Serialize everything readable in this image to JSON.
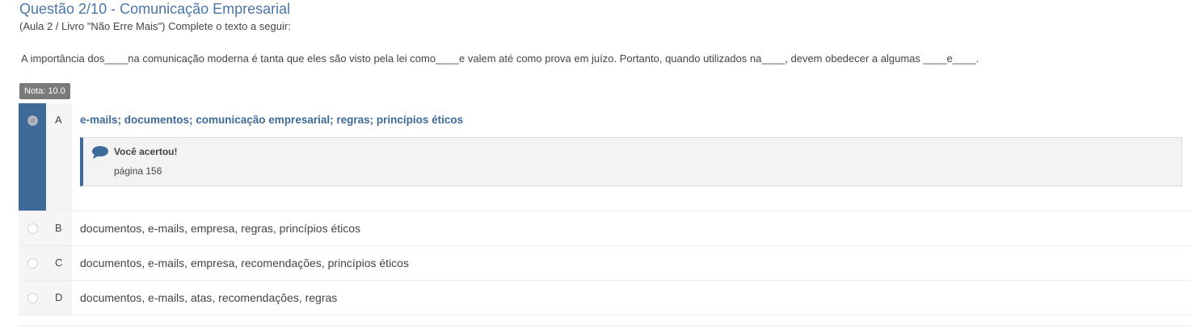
{
  "header": {
    "title": "Questão 2/10 - Comunicação Empresarial",
    "subtitle": "(Aula 2 / Livro \"Não Erre Mais\") Complete o texto a seguir:"
  },
  "question": {
    "text": "A importância dos____na comunicação moderna é tanta que eles são visto pela lei como____e valem até como prova em juízo. Portanto, quando utilizados na____, devem obedecer a algumas ____e____."
  },
  "badge": {
    "label": "Nota: 10.0"
  },
  "options": [
    {
      "letter": "A",
      "text": "e-mails; documentos; comunicação empresarial; regras; princípios éticos",
      "selected": true
    },
    {
      "letter": "B",
      "text": "documentos, e-mails, empresa, regras, princípios éticos",
      "selected": false
    },
    {
      "letter": "C",
      "text": "documentos, e-mails, empresa, recomendações, princípios éticos",
      "selected": false
    },
    {
      "letter": "D",
      "text": "documentos, e-mails, atas, recomendações, regras",
      "selected": false
    }
  ],
  "feedback": {
    "title": "Você acertou!",
    "text": "página 156",
    "icon": "comment-icon"
  },
  "colors": {
    "accent": "#3e6a99",
    "title": "#4a77a8",
    "badge": "#7a7a7a"
  }
}
